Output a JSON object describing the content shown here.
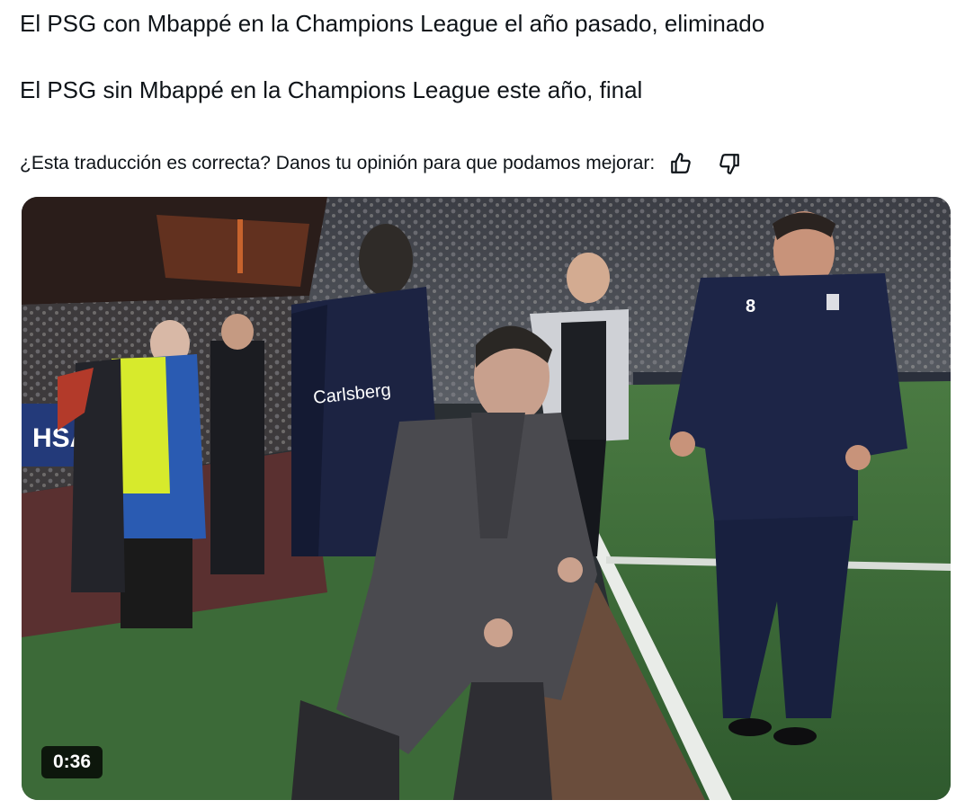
{
  "tweet": {
    "line1": "El PSG con Mbappé en la Champions League el año pasado, eliminado",
    "line2": "El PSG sin Mbappé en la Champions League este año, final"
  },
  "translation_feedback": {
    "question": "¿Esta traducción es correcta? Danos tu opinión para que podamos mejorar:",
    "icons": [
      "thumbs-up-icon",
      "thumbs-down-icon"
    ]
  },
  "video": {
    "duration": "0:36",
    "board_text": "HSA",
    "jacket_text": "Carlsberg"
  },
  "colors": {
    "text": "#0f1419",
    "pitch": "#3f6b3a",
    "duration_badge_bg": "#000000"
  }
}
